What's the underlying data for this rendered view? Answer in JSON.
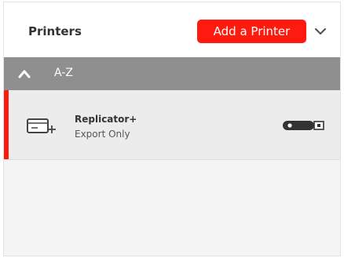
{
  "header": {
    "title": "Printers",
    "add_button_label": "Add a Printer",
    "menu_icon": "chevron-down-icon"
  },
  "group": {
    "label": "A-Z",
    "toggle_icon": "chevron-up-icon"
  },
  "printers": [
    {
      "name": "Replicator+",
      "status": "Export Only",
      "icon": "printer-add-icon",
      "connection_icon": "usb-icon"
    }
  ],
  "colors": {
    "accent": "#ff1a0f",
    "group_bar": "#8f8f8f",
    "row_background": "#ececec"
  }
}
